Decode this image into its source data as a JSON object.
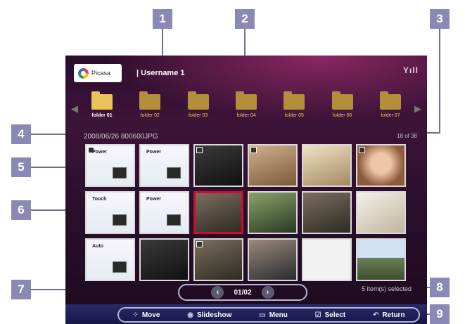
{
  "callouts": [
    "1",
    "2",
    "3",
    "4",
    "5",
    "6",
    "7",
    "8",
    "9"
  ],
  "header": {
    "logo_text": "Picasa",
    "username": "| Username 1",
    "signal": "Yıll"
  },
  "folders": [
    {
      "label": "folder 01",
      "active": true
    },
    {
      "label": "folder 02"
    },
    {
      "label": "folder 03"
    },
    {
      "label": "folder 04"
    },
    {
      "label": "folder 05"
    },
    {
      "label": "folder 06"
    },
    {
      "label": "folder 07"
    }
  ],
  "file": {
    "name": "2008/06/26 800600JPG",
    "counter": "18 of 38"
  },
  "thumb_texts": {
    "t1": "Power",
    "t2": "Power",
    "t7": "Touch",
    "t8": "Power",
    "t13": "Auto"
  },
  "pager": {
    "prev": "‹",
    "page": "01/02",
    "next": "›"
  },
  "selection": {
    "count_text": "5 item(s) selected"
  },
  "hints": {
    "move": "Move",
    "slideshow": "Slideshow",
    "menu": "Menu",
    "select": "Select",
    "return": "Return",
    "move_icon": "⁘",
    "slideshow_icon": "◉",
    "menu_icon": "▭",
    "select_icon": "☑",
    "return_icon": "↶"
  }
}
